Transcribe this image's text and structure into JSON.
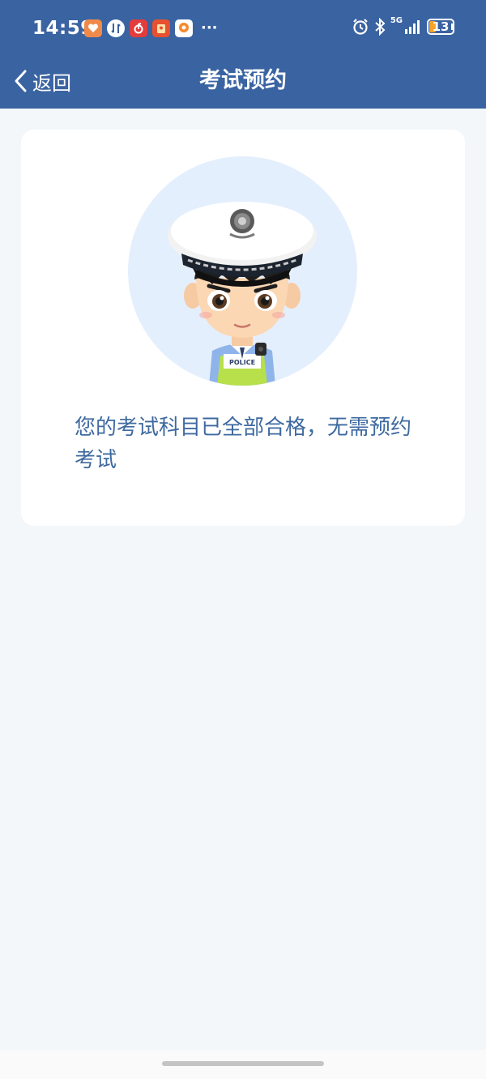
{
  "status_bar": {
    "time": "14:59",
    "battery_level": "13",
    "network": "5G",
    "notification_icons": [
      "health-app-icon",
      "exchange-app-icon",
      "netease-music-icon",
      "red-envelope-app-icon",
      "orange-app-icon"
    ],
    "more": "···"
  },
  "header": {
    "back_label": "返回",
    "title": "考试预约",
    "background_color": "#3a63a2"
  },
  "card": {
    "message": "您的考试科目已全部合格，无需预约考试",
    "illustration": "police-officer-avatar",
    "illustration_badge_text": "POLICE"
  },
  "colors": {
    "accent": "#3a63a2",
    "message_text": "#3f6aa0",
    "page_background": "#f3f7f9",
    "battery_fill": "#f7a22a"
  }
}
